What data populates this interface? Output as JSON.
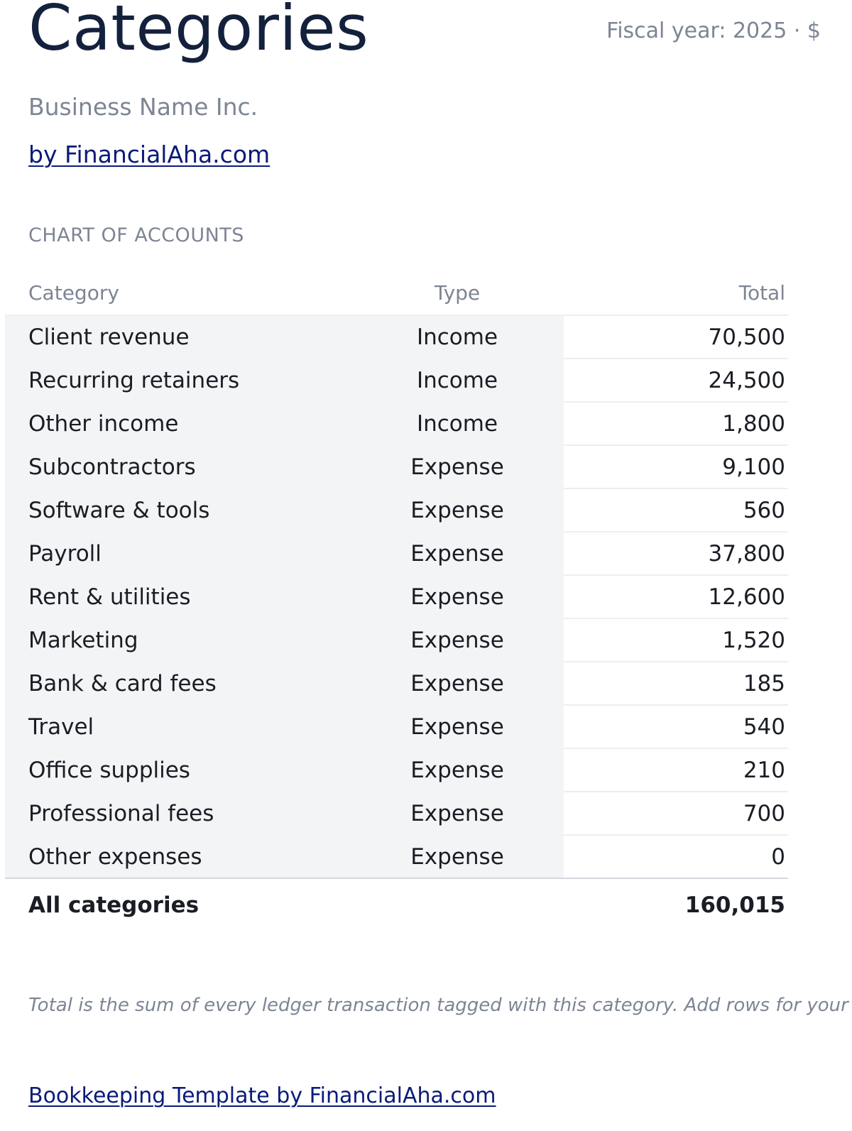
{
  "header": {
    "title": "Categories",
    "fiscal_year": "Fiscal year: 2025 · $",
    "business_name": "Business Name Inc.",
    "byline": "by FinancialAha.com"
  },
  "section": {
    "label": "CHART OF ACCOUNTS"
  },
  "table": {
    "columns": {
      "category": "Category",
      "type": "Type",
      "total": "Total"
    },
    "rows": [
      {
        "category": "Client revenue",
        "type": "Income",
        "total": "70,500"
      },
      {
        "category": "Recurring retainers",
        "type": "Income",
        "total": "24,500"
      },
      {
        "category": "Other income",
        "type": "Income",
        "total": "1,800"
      },
      {
        "category": "Subcontractors",
        "type": "Expense",
        "total": "9,100"
      },
      {
        "category": "Software & tools",
        "type": "Expense",
        "total": "560"
      },
      {
        "category": "Payroll",
        "type": "Expense",
        "total": "37,800"
      },
      {
        "category": "Rent & utilities",
        "type": "Expense",
        "total": "12,600"
      },
      {
        "category": "Marketing",
        "type": "Expense",
        "total": "1,520"
      },
      {
        "category": "Bank & card fees",
        "type": "Expense",
        "total": "185"
      },
      {
        "category": "Travel",
        "type": "Expense",
        "total": "540"
      },
      {
        "category": "Office supplies",
        "type": "Expense",
        "total": "210"
      },
      {
        "category": "Professional fees",
        "type": "Expense",
        "total": "700"
      },
      {
        "category": "Other expenses",
        "type": "Expense",
        "total": "0"
      }
    ],
    "footer": {
      "label": "All categories",
      "total": "160,015"
    }
  },
  "note": "Total is the sum of every ledger transaction tagged with this category. Add rows for your",
  "footer_link": "Bookkeeping Template by FinancialAha.com"
}
